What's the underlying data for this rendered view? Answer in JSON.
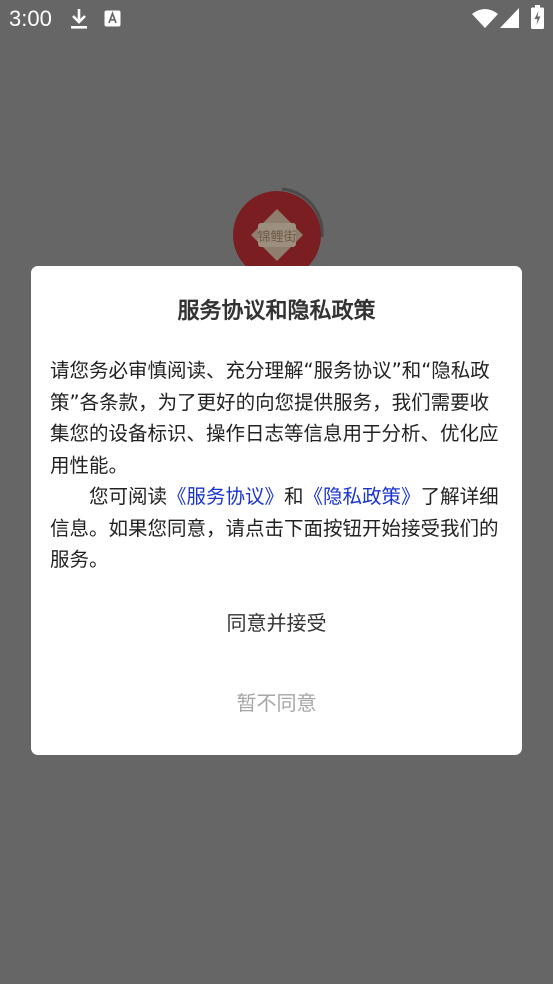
{
  "status_bar": {
    "time": "3:00",
    "icons": [
      "download-icon",
      "font-a-icon",
      "wifi-icon",
      "signal-icon",
      "battery-charging-icon"
    ]
  },
  "splash": {
    "logo_text": "锦鲤街",
    "logo_colors": {
      "outer": "#b8262b",
      "inner": "#f2dcc0"
    }
  },
  "dialog": {
    "title": "服务协议和隐私政策",
    "paragraph1": "请您务必审慎阅读、充分理解“服务协议”和“隐私政策”各条款，为了更好的向您提供服务，我们需要收集您的设备标识、操作日志等信息用于分析、优化应用性能。",
    "paragraph2_prefix": "您可阅读",
    "service_agreement_link": "《服务协议》",
    "paragraph2_and": "和",
    "privacy_policy_link": "《隐私政策》",
    "paragraph2_suffix": "了解详细信息。如果您同意，请点击下面按钮开始接受我们的服务。",
    "accept_label": "同意并接受",
    "decline_label": "暂不同意"
  },
  "colors": {
    "overlay": "#666666",
    "link": "#1a33cc",
    "decline_text": "#a6a6a6"
  }
}
